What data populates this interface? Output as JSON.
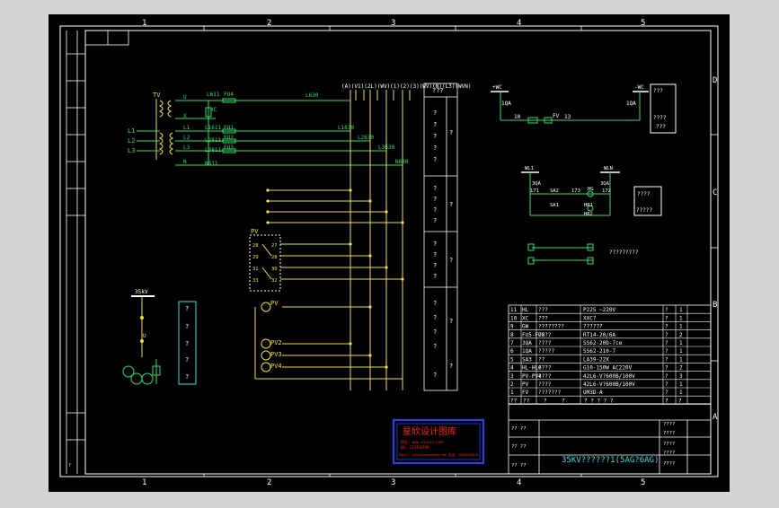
{
  "colors": {
    "bg": "#000000",
    "frame": "#ffffff",
    "green": "#2fe06a",
    "yellow": "#f0e040",
    "cyan": "#38e0e0",
    "red": "#ff2020",
    "blue": "#2040ff"
  },
  "frame": {
    "cols_top": [
      "1",
      "2",
      "3",
      "4",
      "5"
    ],
    "cols_bottom": [
      "1",
      "2",
      "3",
      "4",
      "5"
    ],
    "rows": [
      "D",
      "C",
      "B",
      "A"
    ]
  },
  "left_labels": {
    "TV": "TV",
    "L1": "L1",
    "L2": "L2",
    "L3": "L3",
    "N": "N",
    "PV_box": "PV",
    "PV": "PV",
    "PV2": "PV2",
    "PV3": "PV3",
    "PV4": "PV4",
    "kv35": "35kV",
    "u": "U"
  },
  "wire_labels": {
    "u_l": "U",
    "x": "X",
    "l1": "L1",
    "l2": "L2",
    "l3": "L3",
    "n": "N",
    "l611": "L611",
    "fu4": "FU4",
    "xc": "XC",
    "fu1": "FU1",
    "fu2": "FU2",
    "fu3": "FU3",
    "l1611": "L1611",
    "l2811": "L2811",
    "l3811": "L3811",
    "n611": "N611",
    "l630": "L630",
    "l1630": "L1630",
    "l2630": "L2630",
    "l3630": "L3630",
    "n630": "N630"
  },
  "bus_header": "(A)(V1)(2L)(WV)(1)(2)(3)(WV)(N)(L3)(WVN)",
  "pv_terms": {
    "left": [
      "28",
      "29",
      "31",
      "33"
    ],
    "right": [
      "27",
      "28",
      "30",
      "32"
    ]
  },
  "left_box_q": [
    "?",
    "?",
    "?",
    "?",
    "?"
  ],
  "right_panel": {
    "title": "???",
    "q1": [
      "?",
      "?",
      "?",
      "?",
      "?"
    ],
    "q2": [
      "?",
      "?",
      "?",
      "?"
    ],
    "q3": [
      "?",
      "?",
      "?",
      "?"
    ],
    "q4": [
      "?",
      "?",
      "?",
      "?",
      "?"
    ],
    "side": [
      "?",
      "?",
      "?",
      "?",
      "?"
    ]
  },
  "dc": {
    "pwc": "+WC",
    "mwc": "-WC",
    "f1": "1QA",
    "f2": "1QA",
    "fv": "FV",
    "t1": "10",
    "t2": "13",
    "box": [
      "???",
      "????",
      "???"
    ]
  },
  "sig": {
    "wl1": "WL1",
    "wl2": "WLN",
    "q1": "3QA",
    "q2": "3QA",
    "sa2": "SA2",
    "n1": "173",
    "hg": "HG",
    "n2": "171",
    "n3": "172",
    "sa1": "SA1",
    "hr": "HR1",
    "hr2": "HR2",
    "box": [
      "????",
      "?????"
    ]
  },
  "bottom_circuit_label": "?????????",
  "bom": [
    [
      "11",
      "HL",
      "???",
      "P225 ~220V",
      "?",
      "1"
    ],
    [
      "10",
      "XC",
      "???",
      "XXC?",
      "?",
      "1"
    ],
    [
      "9",
      "GW",
      "????????",
      "??????",
      "?",
      "1"
    ],
    [
      "8",
      "FU5-FU8",
      "????",
      "RT14-20/6A",
      "?",
      "2"
    ],
    [
      "7",
      "3QA",
      "????",
      "SS62-20b-7ce",
      "?",
      "1"
    ],
    [
      "6",
      "1QA",
      "?????",
      "SS62-210-7",
      "?",
      "1"
    ],
    [
      "5",
      "SA3",
      "??",
      "LA39-22X",
      "?",
      "1"
    ],
    [
      "4",
      "HL-HL6",
      "????",
      "G10-150W AC220V",
      "?",
      "2"
    ],
    [
      "3",
      "PV-PV4",
      "????",
      "42L6-V?600B/100V",
      "?",
      "3"
    ],
    [
      "2",
      "PV",
      "????",
      "42L6-V?600B/100V",
      "?",
      "1"
    ],
    [
      "1",
      "FV",
      "???????",
      "UM3D-A",
      "?",
      "1"
    ]
  ],
  "bom_header": [
    "??",
    "??",
    "?",
    "?",
    "? ? ? ? ?",
    "?",
    "?"
  ],
  "title_block": {
    "title": "35KV??????1(5AG?6AG)",
    "c1": "?? ??",
    "c2": "?? ??",
    "c3": "?? ??",
    "r1": "????",
    "r2": "????",
    "r3": "????",
    "r4": "????",
    "r5": "????"
  },
  "stamp": {
    "title": "星欣设计图库",
    "l1": "网址: www.xinxin.com",
    "l2": "QQ: 123456789",
    "l3": "Email: xinxindesign@qq.com  电话: 13012345678"
  }
}
